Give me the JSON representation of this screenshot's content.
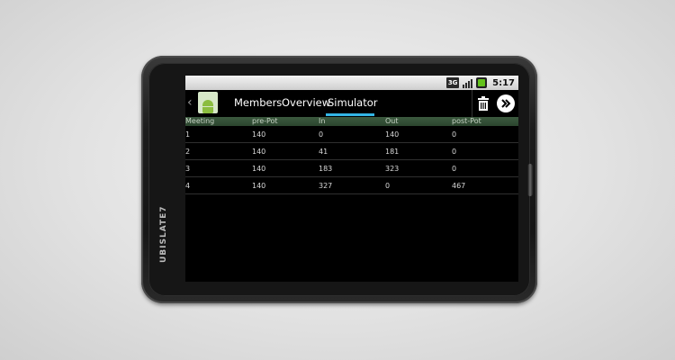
{
  "device": {
    "brand": "UBISLATE7"
  },
  "status_bar": {
    "network_label": "3G",
    "time": "5:17"
  },
  "action_bar": {
    "tabs": [
      {
        "label": "Members"
      },
      {
        "label": "Overview"
      },
      {
        "label": "Simulator"
      }
    ],
    "selected_tab": "Simulator",
    "accent_color": "#33b5e5"
  },
  "table": {
    "columns": [
      "Meeting",
      "pre-Pot",
      "In",
      "Out",
      "post-Pot"
    ],
    "rows": [
      [
        "1",
        "140",
        "0",
        "140",
        "0"
      ],
      [
        "2",
        "140",
        "41",
        "181",
        "0"
      ],
      [
        "3",
        "140",
        "183",
        "323",
        "0"
      ],
      [
        "4",
        "140",
        "327",
        "0",
        "467"
      ]
    ]
  }
}
